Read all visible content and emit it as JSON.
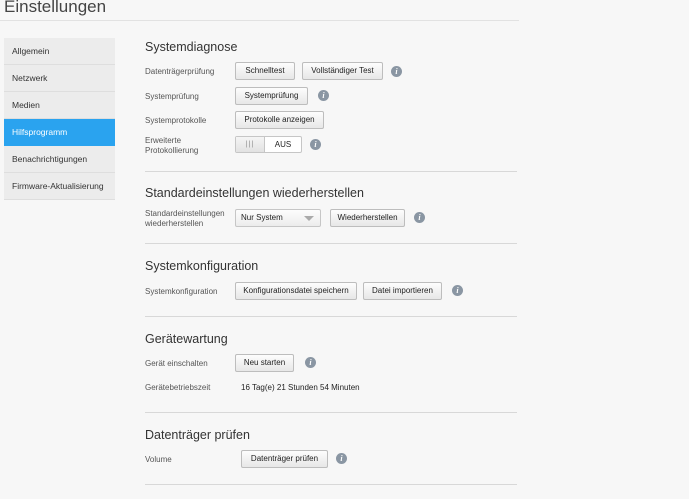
{
  "page": {
    "title": "Einstellungen"
  },
  "sidebar": {
    "items": [
      {
        "label": "Allgemein"
      },
      {
        "label": "Netzwerk"
      },
      {
        "label": "Medien"
      },
      {
        "label": "Hilfsprogramm"
      },
      {
        "label": "Benachrichtigungen"
      },
      {
        "label": "Firmware-Aktualisierung"
      }
    ],
    "active_index": 3
  },
  "sections": {
    "diagnose": {
      "title": "Systemdiagnose",
      "disk_check_label": "Datenträgerprüfung",
      "quick_test": "Schnelltest",
      "full_test": "Vollständiger Test",
      "system_check_label": "Systemprüfung",
      "system_check_button": "Systemprüfung",
      "logs_label": "Systemprotokolle",
      "logs_button": "Protokolle anzeigen",
      "extended_logging_label_1": "Erweiterte",
      "extended_logging_label_2": "Protokollierung",
      "toggle_knob": "|||",
      "toggle_state": "AUS"
    },
    "restore": {
      "title": "Standardeinstellungen wiederherstellen",
      "label_1": "Standardeinstellungen",
      "label_2": "wiederherstellen",
      "select_value": "Nur System",
      "button": "Wiederherstellen"
    },
    "config": {
      "title": "Systemkonfiguration",
      "label": "Systemkonfiguration",
      "save_button": "Konfigurationsdatei speichern",
      "import_button": "Datei importieren"
    },
    "maintenance": {
      "title": "Gerätewartung",
      "power_label": "Gerät einschalten",
      "restart_button": "Neu starten",
      "uptime_label": "Gerätebetriebszeit",
      "uptime_value": "16 Tag(e) 21 Stunden 54 Minuten"
    },
    "disk": {
      "title": "Datenträger prüfen",
      "volume_label": "Volume",
      "check_button": "Datenträger prüfen"
    }
  },
  "icons": {
    "info": "i"
  }
}
